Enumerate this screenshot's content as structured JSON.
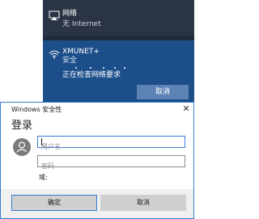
{
  "network": {
    "wired_name": "网络",
    "wired_status": "无 Internet",
    "wifi_ssid": "XMUNET+",
    "wifi_security": "安全",
    "wifi_status": "正在检查网络要求",
    "cancel_label": "取消"
  },
  "dialog": {
    "title": "Windows 安全性",
    "close_glyph": "✕",
    "heading": "登录",
    "username_placeholder": "用户名",
    "password_placeholder": "密码",
    "domain_label": "域:",
    "ok_label": "确定",
    "cancel_label": "取消"
  },
  "colors": {
    "flyout_bg": "#1f2a3a",
    "wifi_panel_bg": "#1c4e8a",
    "accent": "#3a7bd5",
    "button_gray": "#cfcfcf"
  }
}
